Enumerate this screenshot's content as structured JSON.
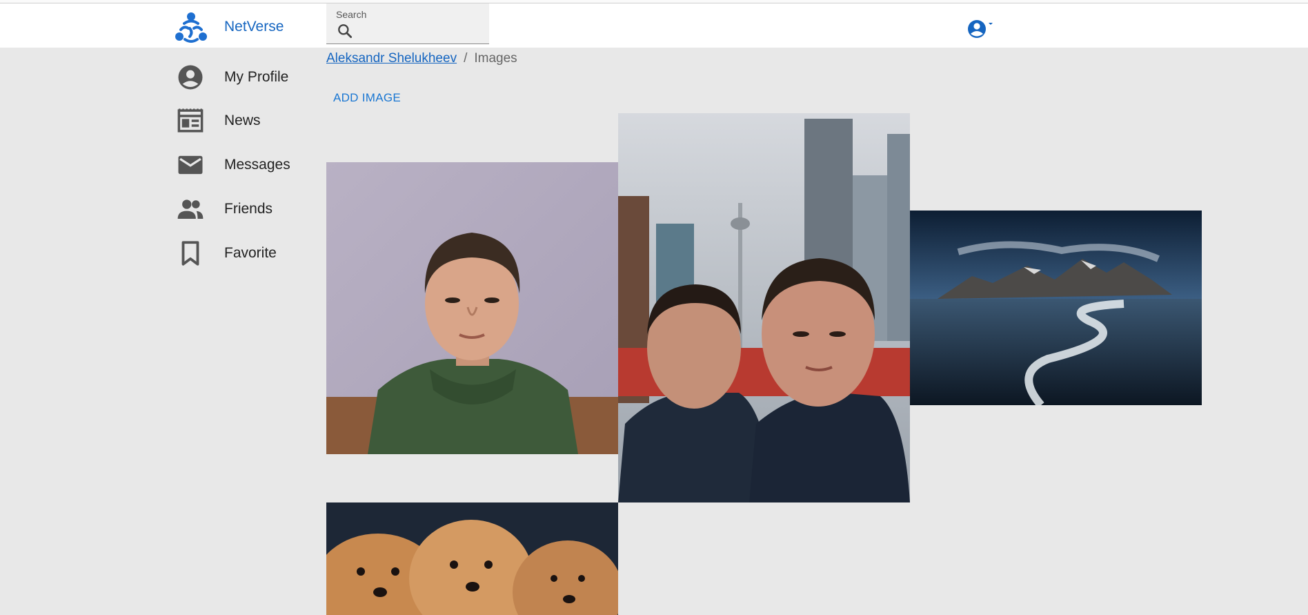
{
  "app": {
    "brand": "NetVerse"
  },
  "search": {
    "label": "Search",
    "value": "",
    "placeholder": ""
  },
  "sidebar": {
    "items": [
      {
        "label": "My Profile",
        "icon": "account-circle-icon"
      },
      {
        "label": "News",
        "icon": "newspaper-icon"
      },
      {
        "label": "Messages",
        "icon": "mail-icon"
      },
      {
        "label": "Friends",
        "icon": "people-icon"
      },
      {
        "label": "Favorite",
        "icon": "bookmark-icon"
      }
    ]
  },
  "breadcrumb": {
    "user": "Aleksandr Shelukheev",
    "separator": "/",
    "current": "Images"
  },
  "actions": {
    "add_image": "ADD IMAGE"
  },
  "gallery": {
    "images": [
      {
        "subject": "portrait-green-hoodie"
      },
      {
        "subject": "selfie-two-men-city-tower"
      },
      {
        "subject": "mountain-lake-landscape"
      },
      {
        "subject": "three-puppies"
      }
    ]
  },
  "colors": {
    "brand": "#1565c0",
    "accent": "#1976d2",
    "background": "#e8e8e8",
    "icon": "#555555"
  }
}
